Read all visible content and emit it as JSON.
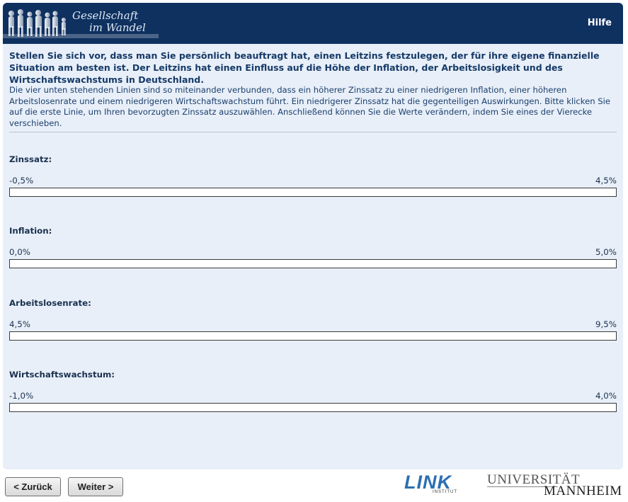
{
  "header": {
    "logo_line1": "Gesellschaft",
    "logo_line2": "im Wandel",
    "help_label": "Hilfe"
  },
  "question": {
    "title": "Stellen Sie sich vor, dass man Sie persönlich beauftragt hat, einen Leitzins festzulegen, der für ihre eigene finanzielle Situation am besten ist. Der Leitzins hat einen Einfluss auf die Höhe der Inflation, der Arbeitslosigkeit und des Wirtschaftswachstums in Deutschland.",
    "instruction": "Die vier unten stehenden Linien sind so miteinander verbunden, dass ein höherer Zinssatz zu einer niedrigeren Inflation, einer höheren Arbeitslosenrate und einem niedrigeren Wirtschaftswachstum führt. Ein niedrigerer Zinssatz hat die gegenteiligen Auswirkungen. Bitte klicken Sie auf die erste Linie, um Ihren bevorzugten Zinssatz auszuwählen. Anschließend können Sie die Werte verändern, indem Sie eines der Vierecke verschieben."
  },
  "sliders": [
    {
      "label": "Zinssatz:",
      "min": "-0,5%",
      "max": "4,5%"
    },
    {
      "label": "Inflation:",
      "min": "0,0%",
      "max": "5,0%"
    },
    {
      "label": "Arbeitslosenrate:",
      "min": "4,5%",
      "max": "9,5%"
    },
    {
      "label": "Wirtschaftswachstum:",
      "min": "-1,0%",
      "max": "4,0%"
    }
  ],
  "footer": {
    "back_label": "< Zurück",
    "next_label": "Weiter >",
    "link_logo": "LINK",
    "link_sub": "INSTITUT",
    "uni_line1": "UNIVERSITÄT",
    "uni_line2": "MANNHEIM"
  },
  "colors": {
    "header_bg": "#0f3160",
    "panel_bg": "#e8eff8",
    "text": "#1a3050"
  }
}
